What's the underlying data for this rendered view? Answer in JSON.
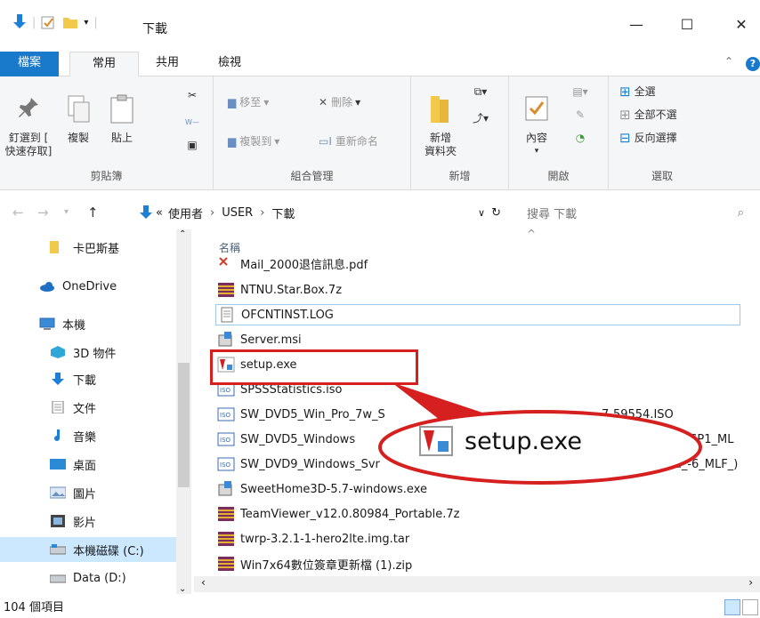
{
  "titlebar": {
    "title": "下載"
  },
  "ribbon_tabs": {
    "file": "檔案",
    "home": "常用",
    "share": "共用",
    "view": "檢視"
  },
  "ribbon": {
    "clipboard": {
      "label": "剪貼簿",
      "pin": "釘選到 [",
      "pin2": "快速存取]",
      "copy": "複製",
      "paste": "貼上"
    },
    "organize": {
      "label": "組合管理",
      "move_to": "移至",
      "delete": "刪除",
      "copy_to": "複製到",
      "rename": "重新命名"
    },
    "new": {
      "label": "新增",
      "new_folder": "新增",
      "new_folder2": "資料夾"
    },
    "open": {
      "label": "開啟",
      "properties": "內容"
    },
    "select": {
      "label": "選取",
      "select_all": "全選",
      "select_none": "全部不選",
      "invert": "反向選擇"
    }
  },
  "address": {
    "parts": [
      "使用者",
      "USER",
      "下載"
    ],
    "search_placeholder": "搜尋 下載"
  },
  "nav": {
    "items": [
      {
        "label": "卡巴斯基",
        "icon": "folder-icon"
      },
      {
        "label": "OneDrive",
        "icon": "cloud-icon"
      },
      {
        "label": "本機",
        "icon": "computer-icon"
      },
      {
        "label": "3D 物件",
        "icon": "cube-icon"
      },
      {
        "label": "下載",
        "icon": "download-icon"
      },
      {
        "label": "文件",
        "icon": "document-icon"
      },
      {
        "label": "音樂",
        "icon": "music-icon"
      },
      {
        "label": "桌面",
        "icon": "desktop-icon"
      },
      {
        "label": "圖片",
        "icon": "pictures-icon"
      },
      {
        "label": "影片",
        "icon": "video-icon"
      },
      {
        "label": "本機磁碟 (C:)",
        "icon": "drive-icon"
      },
      {
        "label": "Data (D:)",
        "icon": "drive-icon"
      }
    ]
  },
  "files": {
    "column_name": "名稱",
    "rows": [
      "Mail_2000退信訊息.pdf",
      "NTNU.Star.Box.7z",
      "OFCNTINST.LOG",
      "Server.msi",
      "setup.exe",
      "SPSSStatistics.iso",
      "SW_DVD5_Win_Pro_7w_S",
      "SW_DVD5_Windows",
      "SW_DVD9_Windows_Svr",
      "SweetHome3D-5.7-windows.exe",
      "TeamViewer_v12.0.80984_Portable.7z",
      "twrp-3.2.1-1-hero2lte.img.tar",
      "Win7x64數位簽章更新檔 (1).zip"
    ],
    "row7_tail": "7-59554.ISO",
    "row8_tail": "w_SP1_ML",
    "row9_tail": "hTrad_-6_MLF_)"
  },
  "callout": {
    "label": "setup.exe"
  },
  "status": {
    "count": "104 個項目"
  },
  "colors": {
    "accent": "#1979ca",
    "highlight": "#d62020",
    "selected_nav": "#cce8ff"
  }
}
